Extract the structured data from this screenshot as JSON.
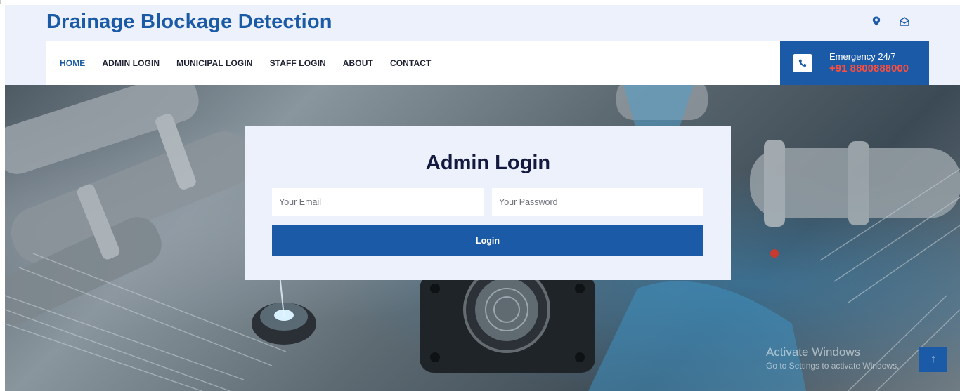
{
  "header": {
    "brand": "Drainage Blockage Detection",
    "icons": [
      "location-icon",
      "mail-icon"
    ]
  },
  "nav": {
    "items": [
      {
        "label": "HOME",
        "active": true
      },
      {
        "label": "ADMIN LOGIN",
        "active": false
      },
      {
        "label": "MUNICIPAL LOGIN",
        "active": false
      },
      {
        "label": "STAFF LOGIN",
        "active": false
      },
      {
        "label": "ABOUT",
        "active": false
      },
      {
        "label": "CONTACT",
        "active": false
      }
    ]
  },
  "emergency": {
    "label": "Emergency 24/7",
    "phone": "+91 8800888000",
    "icon": "phone-icon"
  },
  "login": {
    "title": "Admin Login",
    "email_placeholder": "Your Email",
    "password_placeholder": "Your Password",
    "button_label": "Login"
  },
  "watermark": {
    "title": "Activate Windows",
    "subtitle": "Go to Settings to activate Windows."
  },
  "back_to_top": {
    "icon": "arrow-up-icon",
    "glyph": "↑"
  },
  "colors": {
    "brand": "#1b5aa6",
    "header_bg": "#edf1fb",
    "title_dark": "#141a3f",
    "emergency_phone": "#ff4d3d"
  }
}
